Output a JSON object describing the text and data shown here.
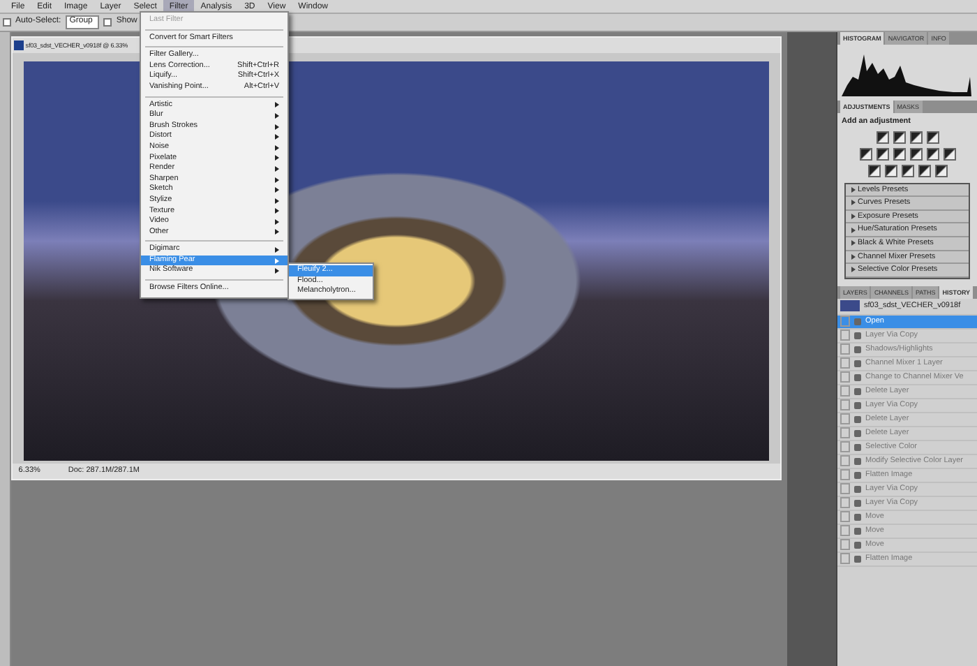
{
  "menu_bar": [
    {
      "label": "File",
      "selected": false
    },
    {
      "label": "Edit",
      "selected": false
    },
    {
      "label": "Image",
      "selected": false
    },
    {
      "label": "Layer",
      "selected": false
    },
    {
      "label": "Select",
      "selected": false
    },
    {
      "label": "Filter",
      "selected": true
    },
    {
      "label": "Analysis",
      "selected": false
    },
    {
      "label": "3D",
      "selected": false
    },
    {
      "label": "View",
      "selected": false
    },
    {
      "label": "Window",
      "selected": false
    }
  ],
  "options_bar": {
    "auto_select_label": "Auto-Select:",
    "auto_select_checked": false,
    "group_value": "Group",
    "show_checked": false,
    "show_label": "Show"
  },
  "document": {
    "title": "sf03_sdst_VECHER_v0918f @ 6.33%",
    "zoom": "6.33%",
    "doc_size": "Doc: 287.1M/287.1M"
  },
  "filter_menu": [
    {
      "kind": "item",
      "label": "Last Filter",
      "disabled": true
    },
    {
      "kind": "separator"
    },
    {
      "kind": "item",
      "label": "Convert for Smart Filters",
      "disabled": false
    },
    {
      "kind": "separator"
    },
    {
      "kind": "item",
      "label": "Filter Gallery...",
      "disabled": false
    },
    {
      "kind": "item",
      "label": "Lens Correction...",
      "shortcut": "Shift+Ctrl+R",
      "disabled": false
    },
    {
      "kind": "item",
      "label": "Liquify...",
      "shortcut": "Shift+Ctrl+X",
      "disabled": false
    },
    {
      "kind": "item",
      "label": "Vanishing Point...",
      "shortcut": "Alt+Ctrl+V",
      "disabled": false
    },
    {
      "kind": "separator"
    },
    {
      "kind": "submenu",
      "label": "Artistic",
      "selected": false
    },
    {
      "kind": "submenu",
      "label": "Blur",
      "selected": false
    },
    {
      "kind": "submenu",
      "label": "Brush Strokes",
      "selected": false
    },
    {
      "kind": "submenu",
      "label": "Distort",
      "selected": false
    },
    {
      "kind": "submenu",
      "label": "Noise",
      "selected": false
    },
    {
      "kind": "submenu",
      "label": "Pixelate",
      "selected": false
    },
    {
      "kind": "submenu",
      "label": "Render",
      "selected": false
    },
    {
      "kind": "submenu",
      "label": "Sharpen",
      "selected": false
    },
    {
      "kind": "submenu",
      "label": "Sketch",
      "selected": false
    },
    {
      "kind": "submenu",
      "label": "Stylize",
      "selected": false
    },
    {
      "kind": "submenu",
      "label": "Texture",
      "selected": false
    },
    {
      "kind": "submenu",
      "label": "Video",
      "selected": false
    },
    {
      "kind": "submenu",
      "label": "Other",
      "selected": false
    },
    {
      "kind": "separator"
    },
    {
      "kind": "submenu",
      "label": "Digimarc",
      "selected": false
    },
    {
      "kind": "submenu",
      "label": "Flaming Pear",
      "selected": true
    },
    {
      "kind": "submenu",
      "label": "Nik Software",
      "selected": false
    },
    {
      "kind": "separator"
    },
    {
      "kind": "item",
      "label": "Browse Filters Online...",
      "disabled": false
    }
  ],
  "flaming_pear_submenu": [
    {
      "label": "Fleuify 2...",
      "selected": true
    },
    {
      "label": "Flood...",
      "selected": false
    },
    {
      "label": "Melancholytron...",
      "selected": false
    }
  ],
  "histogram_tabs": [
    {
      "label": "HISTOGRAM",
      "selected": true
    },
    {
      "label": "NAVIGATOR",
      "selected": false
    },
    {
      "label": "INFO",
      "selected": false
    }
  ],
  "adjustments_tabs": [
    {
      "label": "ADJUSTMENTS",
      "selected": true
    },
    {
      "label": "MASKS",
      "selected": false
    }
  ],
  "adjustments_title": "Add an adjustment",
  "presets": [
    "Levels Presets",
    "Curves Presets",
    "Exposure Presets",
    "Hue/Saturation Presets",
    "Black & White Presets",
    "Channel Mixer Presets",
    "Selective Color Presets"
  ],
  "layer_tabs": [
    {
      "label": "LAYERS",
      "selected": false
    },
    {
      "label": "CHANNELS",
      "selected": false
    },
    {
      "label": "PATHS",
      "selected": false
    },
    {
      "label": "HISTORY",
      "selected": true
    }
  ],
  "snapshot_name": "sf03_sdst_VECHER_v0918f",
  "history": [
    {
      "label": "Open",
      "selected": true
    },
    {
      "label": "Layer Via Copy",
      "selected": false
    },
    {
      "label": "Shadows/Highlights",
      "selected": false
    },
    {
      "label": "Channel Mixer 1 Layer",
      "selected": false
    },
    {
      "label": "Change to Channel Mixer Ve",
      "selected": false
    },
    {
      "label": "Delete Layer",
      "selected": false
    },
    {
      "label": "Layer Via Copy",
      "selected": false
    },
    {
      "label": "Delete Layer",
      "selected": false
    },
    {
      "label": "Delete Layer",
      "selected": false
    },
    {
      "label": "Selective Color",
      "selected": false
    },
    {
      "label": "Modify Selective Color Layer",
      "selected": false
    },
    {
      "label": "Flatten Image",
      "selected": false
    },
    {
      "label": "Layer Via Copy",
      "selected": false
    },
    {
      "label": "Layer Via Copy",
      "selected": false
    },
    {
      "label": "Move",
      "selected": false
    },
    {
      "label": "Move",
      "selected": false
    },
    {
      "label": "Move",
      "selected": false
    },
    {
      "label": "Flatten Image",
      "selected": false
    }
  ]
}
